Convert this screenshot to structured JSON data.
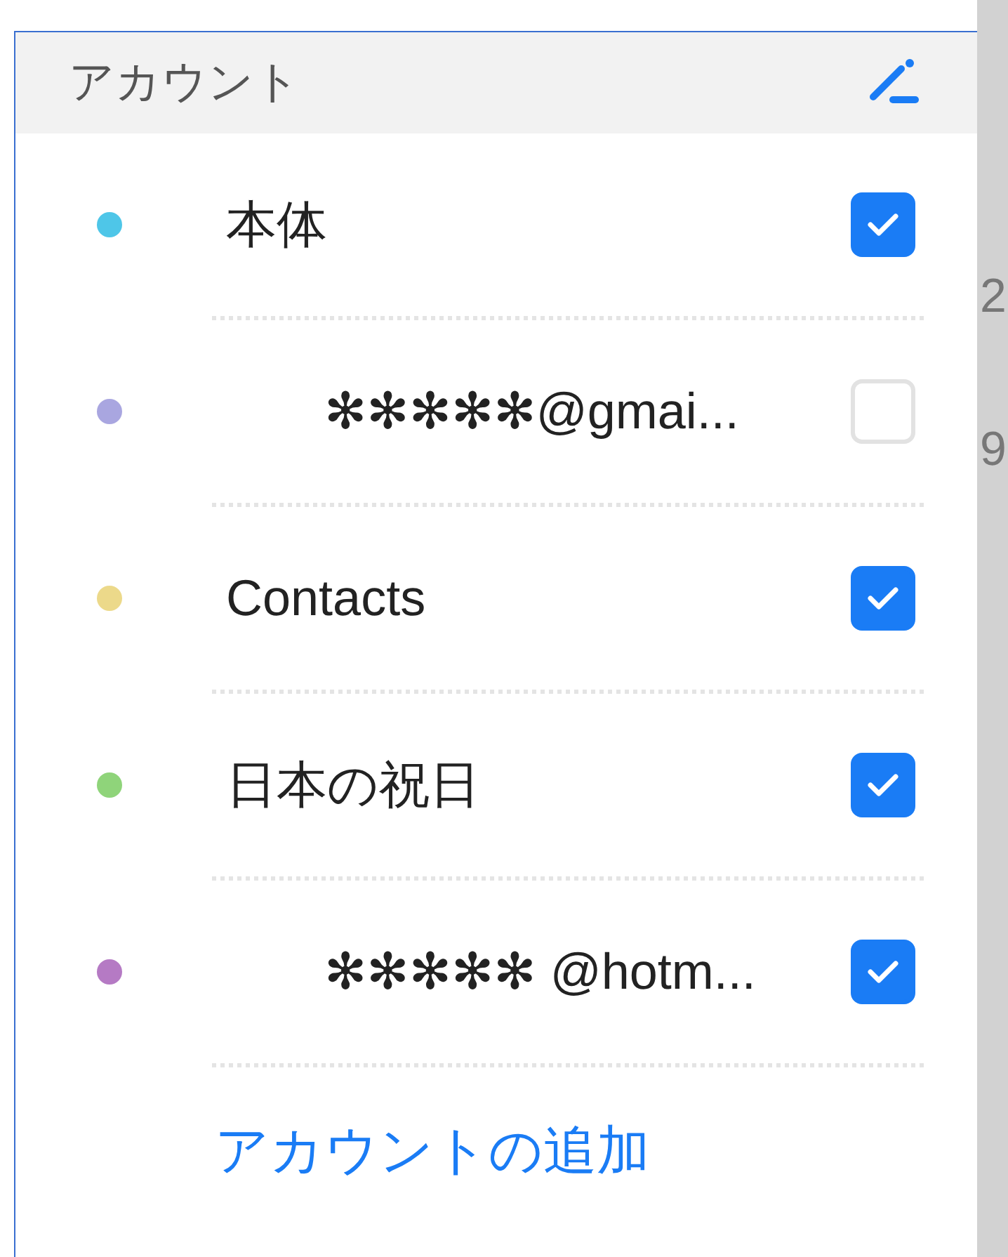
{
  "header": {
    "title": "アカウント"
  },
  "accounts": [
    {
      "kind": "plain",
      "name": "本体",
      "color": "#4ec6e8",
      "checked": true
    },
    {
      "kind": "email",
      "name": "✻✻✻✻✻@gmai...",
      "color": "#a9a6e0",
      "checked": false
    },
    {
      "kind": "plain",
      "name": "Contacts",
      "color": "#ecd98a",
      "checked": true
    },
    {
      "kind": "plain",
      "name": "日本の祝日",
      "color": "#8fd47a",
      "checked": true
    },
    {
      "kind": "email",
      "name": "✻✻✻✻✻ @hotm...",
      "color": "#b57ac4",
      "checked": true
    }
  ],
  "add_account": "アカウントの追加",
  "background_strip": [
    "2",
    "9"
  ]
}
